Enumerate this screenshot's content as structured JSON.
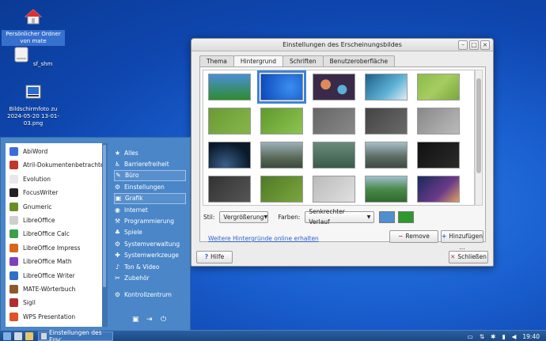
{
  "desktop": {
    "icons": [
      {
        "label": "Persönlicher Ordner von mate"
      },
      {
        "label": "sf_shm"
      },
      {
        "label": "Bildschirmfoto zu 2024-05-20 13-01-03.png"
      }
    ]
  },
  "window": {
    "title": "Einstellungen des Erscheinungsbildes",
    "tabs": [
      "Thema",
      "Hintergrund",
      "Schriften",
      "Benutzeroberfläche"
    ],
    "active_tab": "Hintergrund",
    "style_label": "Stil:",
    "style_value": "Vergrößerung",
    "colors_label": "Farben:",
    "colors_value": "Senkrechter Verlauf",
    "color1": "#4f8fd0",
    "color2": "#2e9a2e",
    "online_link": "Weitere Hintergründe online erhalten",
    "remove_label": "Remove",
    "add_label": "Hinzufügen ...",
    "help_label": "Hilfe",
    "close_label": "Schließen"
  },
  "menu": {
    "apps": [
      {
        "label": "AbiWord",
        "icon": "abiword-icon",
        "color": "#3b6fd8"
      },
      {
        "label": "Atril-Dokumentenbetrachter",
        "icon": "atril-icon",
        "color": "#c0392b"
      },
      {
        "label": "Evolution",
        "icon": "evolution-icon",
        "color": "#e8e8e8"
      },
      {
        "label": "FocusWriter",
        "icon": "focuswriter-icon",
        "color": "#222222"
      },
      {
        "label": "Gnumeric",
        "icon": "gnumeric-icon",
        "color": "#6b8e23"
      },
      {
        "label": "LibreOffice",
        "icon": "libreoffice-icon",
        "color": "#cfcfcf"
      },
      {
        "label": "LibreOffice Calc",
        "icon": "calc-icon",
        "color": "#3aa14a"
      },
      {
        "label": "LibreOffice Impress",
        "icon": "impress-icon",
        "color": "#d9641d"
      },
      {
        "label": "LibreOffice Math",
        "icon": "math-icon",
        "color": "#7f3fbf"
      },
      {
        "label": "LibreOffice Writer",
        "icon": "writer-icon",
        "color": "#2f6fc9"
      },
      {
        "label": "MATE-Wörterbuch",
        "icon": "dictionary-icon",
        "color": "#8b5a2b"
      },
      {
        "label": "Sigil",
        "icon": "sigil-icon",
        "color": "#b03030"
      },
      {
        "label": "WPS Presentation",
        "icon": "wps-icon",
        "color": "#e0502a"
      }
    ],
    "categories": [
      {
        "label": "Alles",
        "icon": "★"
      },
      {
        "label": "Barrierefreiheit",
        "icon": "♿"
      },
      {
        "label": "Büro",
        "icon": "✎"
      },
      {
        "label": "Einstellungen",
        "icon": "⚙"
      },
      {
        "label": "Grafik",
        "icon": "▣"
      },
      {
        "label": "Internet",
        "icon": "◉"
      },
      {
        "label": "Programmierung",
        "icon": "⚒"
      },
      {
        "label": "Spiele",
        "icon": "♣"
      },
      {
        "label": "Systemverwaltung",
        "icon": "⚙"
      },
      {
        "label": "Systemwerkzeuge",
        "icon": "✚"
      },
      {
        "label": "Ton & Video",
        "icon": "♪"
      },
      {
        "label": "Zubehör",
        "icon": "✂"
      },
      {
        "label": "Kontrollzentrum",
        "icon": "⚙"
      }
    ]
  },
  "taskbar": {
    "task_title": "Einstellungen des Ersc...",
    "clock": "19:40"
  }
}
